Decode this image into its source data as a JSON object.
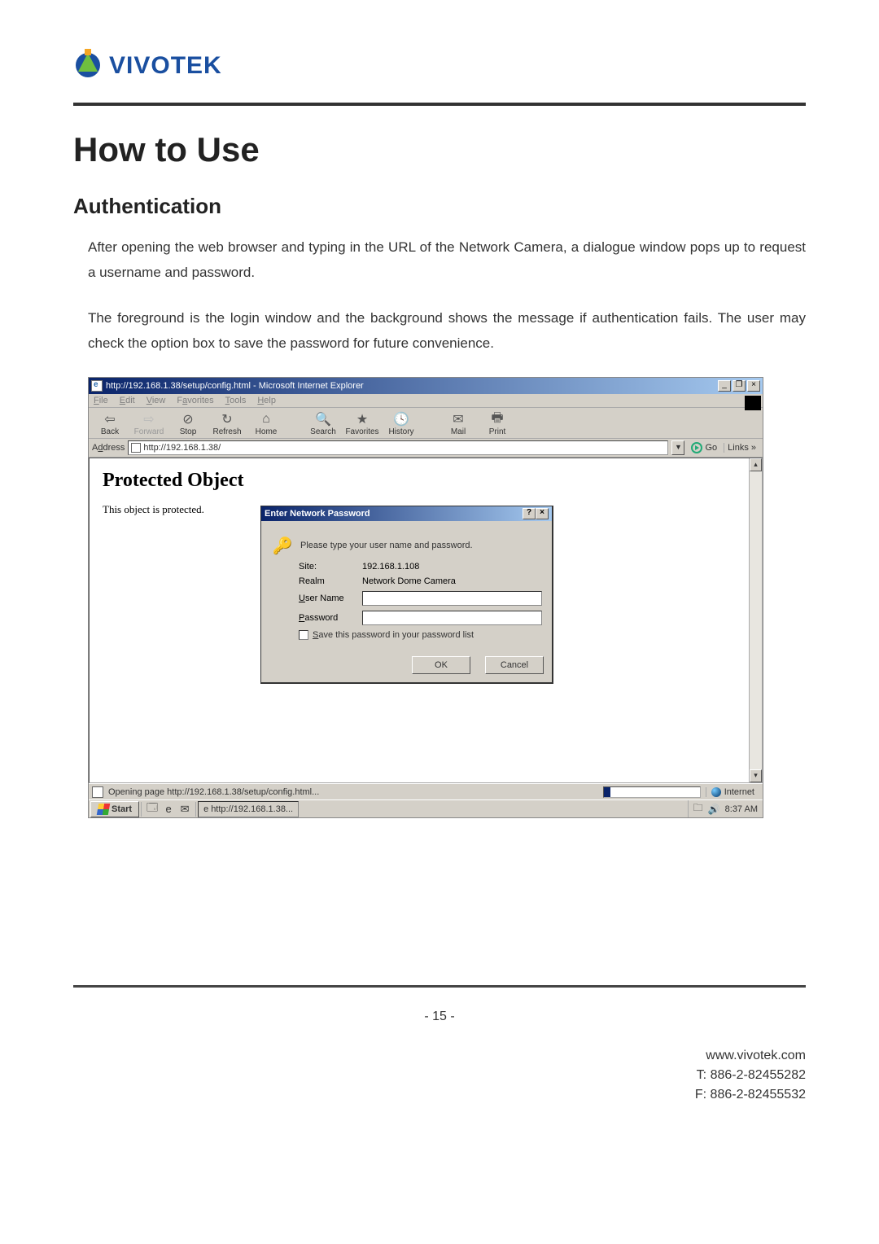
{
  "logo_text": "VIVOTEK",
  "heading1": "How to Use",
  "heading2": "Authentication",
  "para1": "After opening the web browser and typing in the URL of the Network Camera, a dialogue window pops up to request a username and password.",
  "para2": "The foreground is the login window and the background shows the message if authentication fails. The user may check the option box to save the password for future convenience.",
  "ie": {
    "title": "http://192.168.1.38/setup/config.html - Microsoft Internet Explorer",
    "menus": {
      "file": "File",
      "edit": "Edit",
      "view": "View",
      "fav": "Favorites",
      "tools": "Tools",
      "help": "Help"
    },
    "tools": {
      "back": "Back",
      "forward": "Forward",
      "stop": "Stop",
      "refresh": "Refresh",
      "home": "Home",
      "search": "Search",
      "favorites": "Favorites",
      "history": "History",
      "mail": "Mail",
      "print": "Print"
    },
    "address_label": "Address",
    "address_value": "http://192.168.1.38/",
    "go": "Go",
    "links": "Links »",
    "page_title": "Protected Object",
    "page_text": "This object is protected.",
    "status": "Opening page http://192.168.1.38/setup/config.html...",
    "zone": "Internet"
  },
  "dialog": {
    "title": "Enter Network Password",
    "prompt": "Please type your user name and password.",
    "site_label": "Site:",
    "site_value": "192.168.1.108",
    "realm_label": "Realm",
    "realm_value": "Network Dome Camera",
    "user_label": "User Name",
    "pass_label": "Password",
    "save_label": "Save this password in your password list",
    "ok": "OK",
    "cancel": "Cancel"
  },
  "taskbar": {
    "start": "Start",
    "task": "http://192.168.1.38...",
    "time": "8:37 AM"
  },
  "page_number": "- 15 -",
  "footer": {
    "url": "www.vivotek.com",
    "tel": "T: 886-2-82455282",
    "fax": "F: 886-2-82455532"
  }
}
